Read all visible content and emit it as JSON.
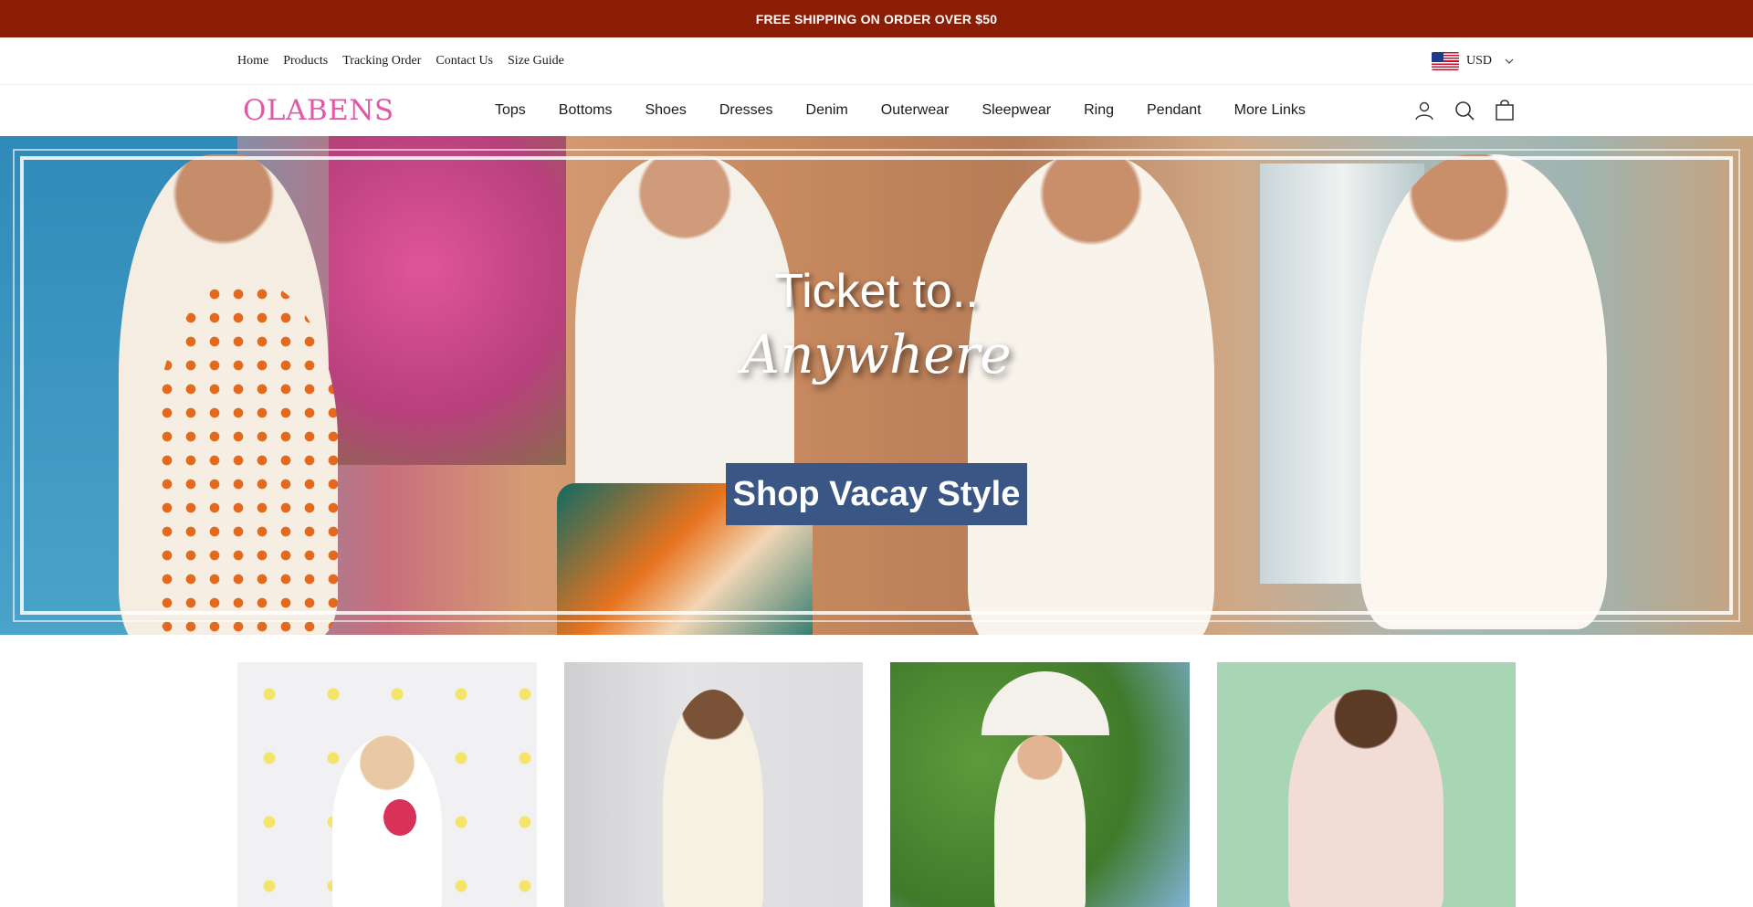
{
  "announcement": {
    "text": "FREE SHIPPING ON ORDER OVER $50"
  },
  "utility_nav": {
    "links": [
      "Home",
      "Products",
      "Tracking Order",
      "Contact Us",
      "Size Guide"
    ],
    "currency": {
      "code": "USD",
      "flag": "us-flag-icon"
    }
  },
  "header": {
    "logo": "OLABENS",
    "menu": [
      "Tops",
      "Bottoms",
      "Shoes",
      "Dresses",
      "Denim",
      "Outerwear",
      "Sleepwear",
      "Ring",
      "Pendant",
      "More Links"
    ],
    "icons": [
      "account-icon",
      "search-icon",
      "cart-icon"
    ]
  },
  "hero": {
    "title_line1": "Ticket to..",
    "title_line2": "Anywhere",
    "cta_label": "Shop Vacay Style",
    "cta_color": "#3a5684"
  },
  "products": [
    {
      "name": "product-card-1",
      "image": "woman in white off-shoulder dress holding pink flowers"
    },
    {
      "name": "product-card-2",
      "image": "woman in cream slip dress"
    },
    {
      "name": "product-card-3",
      "image": "woman in white dress with lace parasol"
    },
    {
      "name": "product-card-4",
      "image": "woman in blush wrap dress"
    }
  ],
  "colors": {
    "announcement_bg": "#8b1d05",
    "logo": "#e05aa8",
    "cta": "#3a5684"
  }
}
